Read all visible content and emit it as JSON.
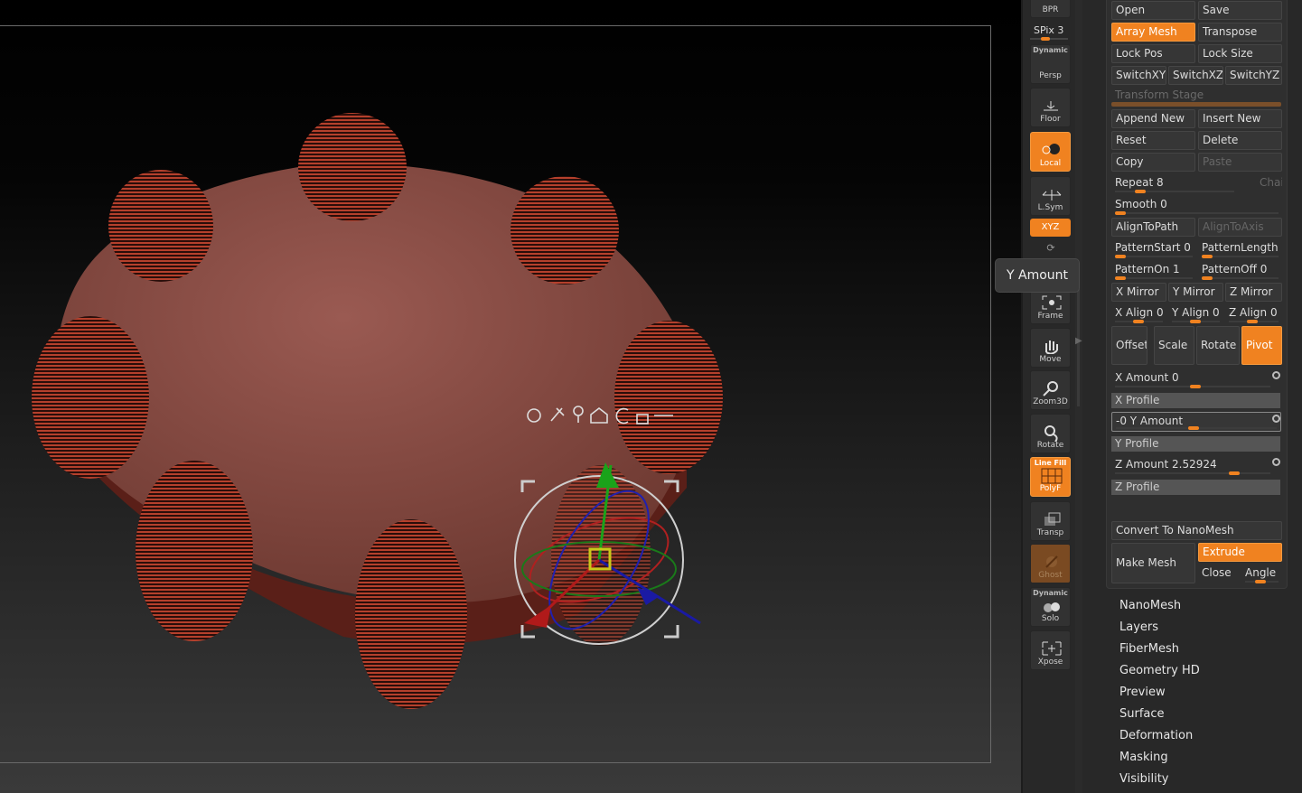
{
  "toolbar": {
    "bpr": "BPR",
    "spix": "SPix 3",
    "persp": {
      "top": "Dynamic",
      "label": "Persp"
    },
    "floor": "Floor",
    "local": "Local",
    "lsym": "L.Sym",
    "xyz": "XYZ",
    "frame": "Frame",
    "move": "Move",
    "zoom3d": "Zoom3D",
    "rotate": "Rotate",
    "polyf": {
      "top": "Line Fill",
      "label": "PolyF"
    },
    "transp": "Transp",
    "ghost": "Ghost",
    "solo": {
      "top": "Dynamic",
      "label": "Solo"
    },
    "xpose": "Xpose"
  },
  "tooltip": "Y Amount",
  "panel": {
    "open": "Open",
    "save": "Save",
    "array_mesh": "Array Mesh",
    "transpose": "Transpose",
    "lock_pos": "Lock Pos",
    "lock_size": "Lock Size",
    "switch_xy": "SwitchXY",
    "switch_xz": "SwitchXZ",
    "switch_yz": "SwitchYZ",
    "transform_stage": "Transform Stage",
    "append_new": "Append New",
    "insert_new": "Insert New",
    "reset": "Reset",
    "delete": "Delete",
    "copy": "Copy",
    "paste": "Paste",
    "repeat": "Repeat 8",
    "chain": "Chain",
    "smooth": "Smooth 0",
    "align_to_path": "AlignToPath",
    "align_to_axis": "AlignToAxis",
    "pattern_start": "PatternStart 0",
    "pattern_length": "PatternLength",
    "pattern_on": "PatternOn 1",
    "pattern_off": "PatternOff 0",
    "x_mirror": "X Mirror",
    "y_mirror": "Y Mirror",
    "z_mirror": "Z Mirror",
    "x_align": "X Align 0",
    "y_align": "Y Align 0",
    "z_align": "Z Align 0",
    "offset": "Offset",
    "scale": "Scale",
    "rotate": "Rotate",
    "pivot": "Pivot",
    "x_amount": "X Amount 0",
    "x_profile": "X Profile",
    "y_amount": "-0 Y Amount",
    "y_profile": "Y Profile",
    "z_amount": "Z Amount 2.52924",
    "z_profile": "Z Profile",
    "convert_nanomesh": "Convert To NanoMesh",
    "make_mesh": "Make Mesh",
    "extrude": "Extrude",
    "close": "Close",
    "angle": "Angle"
  },
  "menu": [
    "NanoMesh",
    "Layers",
    "FiberMesh",
    "Geometry HD",
    "Preview",
    "Surface",
    "Deformation",
    "Masking",
    "Visibility"
  ],
  "colors": {
    "accent": "#f08220",
    "mesh": "#8a4a40",
    "stripes": "#a83a2a"
  }
}
